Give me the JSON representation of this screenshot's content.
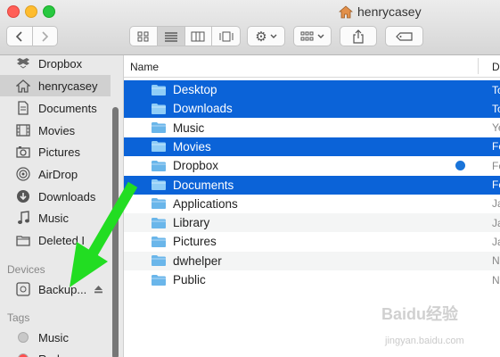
{
  "window": {
    "title": "henrycasey"
  },
  "sidebar": {
    "favorites": [
      {
        "label": "Dropbox",
        "icon": "dropbox-icon"
      },
      {
        "label": "henrycasey",
        "icon": "home-icon",
        "selected": true
      },
      {
        "label": "Documents",
        "icon": "documents-icon"
      },
      {
        "label": "Movies",
        "icon": "movies-icon"
      },
      {
        "label": "Pictures",
        "icon": "pictures-icon"
      },
      {
        "label": "AirDrop",
        "icon": "airdrop-icon"
      },
      {
        "label": "Downloads",
        "icon": "downloads-icon"
      },
      {
        "label": "Music",
        "icon": "music-icon"
      },
      {
        "label": "Deleted I",
        "icon": "folder-icon"
      }
    ],
    "devices_heading": "Devices",
    "devices": [
      {
        "label": "Backup...",
        "icon": "disk-icon"
      }
    ],
    "tags_heading": "Tags",
    "tags": [
      {
        "label": "Music",
        "color": "#c8c8c8"
      },
      {
        "label": "Red",
        "color": "#ff4d4d"
      }
    ]
  },
  "list": {
    "columns": {
      "name": "Name",
      "date": "D"
    },
    "rows": [
      {
        "name": "Desktop",
        "date": "To",
        "selected": true
      },
      {
        "name": "Downloads",
        "date": "To",
        "selected": true
      },
      {
        "name": "Music",
        "date": "Ye",
        "selected": false
      },
      {
        "name": "Movies",
        "date": "Fe",
        "selected": true
      },
      {
        "name": "Dropbox",
        "date": "Fe",
        "selected": false,
        "badge": true
      },
      {
        "name": "Documents",
        "date": "Fe",
        "selected": true
      },
      {
        "name": "Applications",
        "date": "Ja",
        "selected": false
      },
      {
        "name": "Library",
        "date": "Ja",
        "selected": false
      },
      {
        "name": "Pictures",
        "date": "Ja",
        "selected": false
      },
      {
        "name": "dwhelper",
        "date": "N",
        "selected": false
      },
      {
        "name": "Public",
        "date": "N",
        "selected": false
      }
    ]
  },
  "colors": {
    "selection": "#0b63d8",
    "folder": "#6ab6ea",
    "arrow": "#22dd22"
  },
  "watermark": {
    "main": "Baidu经验",
    "sub": "jingyan.baidu.com"
  }
}
